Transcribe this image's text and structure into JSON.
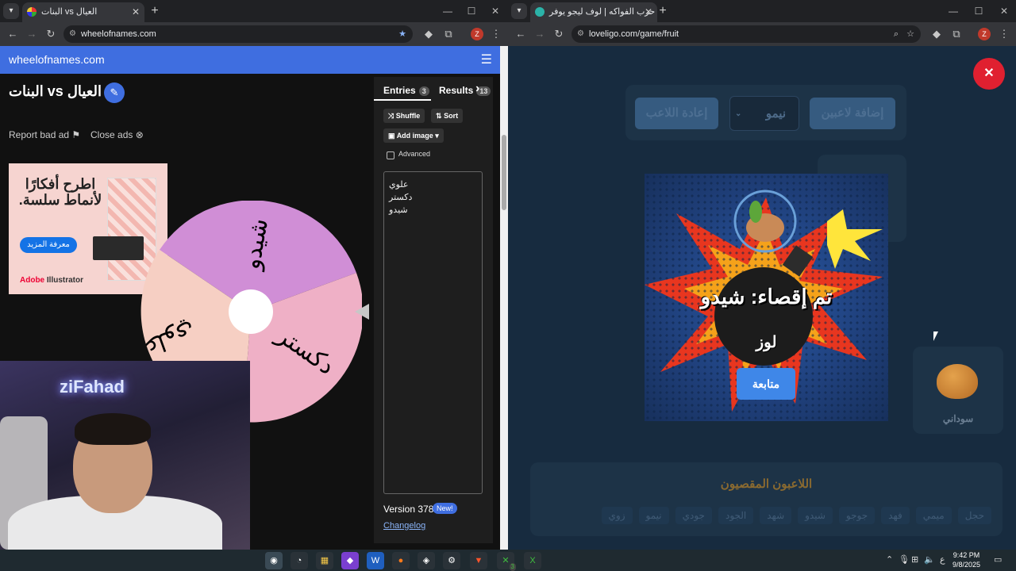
{
  "left_browser": {
    "tab_title": "البنات vs العيال",
    "url": "wheelofnames.com",
    "profile_initial": "Z"
  },
  "right_browser": {
    "tab_title": "لعبة حرب الفواكه | لوف ليجو يوفر",
    "url": "loveligo.com/game/fruit",
    "profile_initial": "Z"
  },
  "wheel_app": {
    "logo": "wheelofnames.com",
    "wheel_title": "البنات vs العيال",
    "report_ad": "Report bad ad",
    "close_ads": "Close ads",
    "ad": {
      "headline": "اطرح أفكارًا لأنماط سلسة.",
      "cta": "معرفة المزيد",
      "brand_a": "Adobe",
      "brand_b": " Illustrator"
    },
    "tabs": {
      "entries": "Entries",
      "entries_count": "3",
      "results": "Results",
      "results_count": "13"
    },
    "buttons": {
      "shuffle": "Shuffle",
      "sort": "Sort",
      "add_image": "Add image",
      "advanced": "Advanced"
    },
    "entries": [
      "علوي",
      "دكستر",
      "شيدو"
    ],
    "version": "Version 378",
    "new_badge": "New!",
    "changelog": "Changelog",
    "wheel_segments": [
      {
        "label": "شيدو",
        "color": "#d08ed6"
      },
      {
        "label": "دكستر",
        "color": "#efb0c6"
      },
      {
        "label": "علوي",
        "color": "#f6cfc3"
      }
    ]
  },
  "webcam": {
    "neon_text": "ziFahad"
  },
  "fruit_game": {
    "add_players": "إضافة لاعبين",
    "selected_player": "نيمو",
    "replay": "إعادة اللاعب",
    "modal_title": "تم إقصاء: شيدو",
    "modal_fruit": "لوز",
    "continue": "متابعة",
    "side_card_label": "سوداني",
    "eliminated_title": "اللاعبون المقصيون",
    "eliminated": [
      "حجل",
      "ميمي",
      "فهد",
      "جوجو",
      "شيدو",
      "شهد",
      "الجود",
      "جودي",
      "نيمو",
      "زوي"
    ]
  },
  "taskbar": {
    "lang": "ع",
    "time": "9:42 PM",
    "date": "9/8/2025",
    "xbox_badge": "3"
  },
  "colors": {
    "accent": "#3f6ee0",
    "danger": "#e02030",
    "game_bg": "#172b3f"
  }
}
